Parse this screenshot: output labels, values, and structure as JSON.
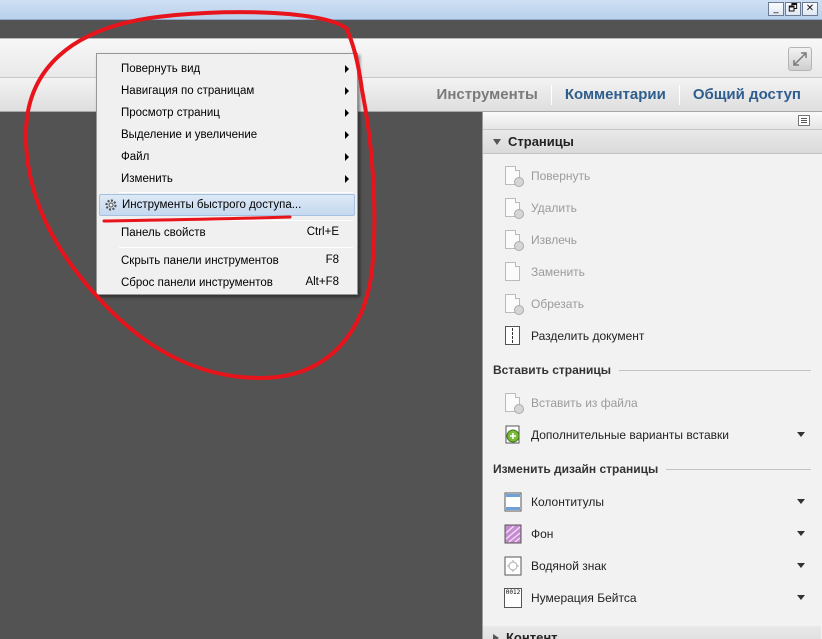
{
  "window": {
    "buttons": [
      "_",
      "🗗",
      "✕"
    ]
  },
  "tabs": [
    {
      "label": "Инструменты",
      "state": "inactive"
    },
    {
      "label": "Комментарии",
      "state": "active"
    },
    {
      "label": "Общий доступ",
      "state": "active"
    }
  ],
  "menu": {
    "items": [
      {
        "label": "Повернуть вид",
        "submenu": true
      },
      {
        "label": "Навигация по страницам",
        "submenu": true
      },
      {
        "label": "Просмотр страниц",
        "submenu": true
      },
      {
        "label": "Выделение и увеличение",
        "submenu": true
      },
      {
        "label": "Файл",
        "submenu": true
      },
      {
        "label": "Изменить",
        "submenu": true
      },
      {
        "label": "Инструменты быстрого доступа...",
        "highlighted": true,
        "icon": "gear-icon"
      },
      {
        "label": "Панель свойств",
        "shortcut": "Ctrl+E"
      },
      {
        "label": "Скрыть панели инструментов",
        "shortcut": "F8"
      },
      {
        "label": "Сброс панели инструментов",
        "shortcut": "Alt+F8"
      }
    ]
  },
  "panel": {
    "section_pages": "Страницы",
    "page_items": [
      {
        "label": "Повернуть",
        "enabled": false,
        "icon": "rotate-page-icon"
      },
      {
        "label": "Удалить",
        "enabled": false,
        "icon": "delete-page-icon"
      },
      {
        "label": "Извлечь",
        "enabled": false,
        "icon": "extract-page-icon"
      },
      {
        "label": "Заменить",
        "enabled": false,
        "icon": "replace-page-icon"
      },
      {
        "label": "Обрезать",
        "enabled": false,
        "icon": "crop-page-icon"
      },
      {
        "label": "Разделить документ",
        "enabled": true,
        "icon": "split-document-icon"
      }
    ],
    "insert_heading": "Вставить страницы",
    "insert_items": [
      {
        "label": "Вставить из файла",
        "enabled": false,
        "icon": "insert-from-file-icon"
      },
      {
        "label": "Дополнительные варианты вставки",
        "enabled": true,
        "icon": "more-insert-options-icon",
        "dropdown": true
      }
    ],
    "design_heading": "Изменить дизайн страницы",
    "design_items": [
      {
        "label": "Колонтитулы",
        "enabled": true,
        "icon": "header-footer-icon",
        "dropdown": true
      },
      {
        "label": "Фон",
        "enabled": true,
        "icon": "background-icon",
        "dropdown": true
      },
      {
        "label": "Водяной знак",
        "enabled": true,
        "icon": "watermark-icon",
        "dropdown": true
      },
      {
        "label": "Нумерация Бейтса",
        "enabled": true,
        "icon": "bates-numbering-icon",
        "dropdown": true,
        "icon_text": "0012"
      }
    ],
    "section_content": "Контент"
  },
  "colors": {
    "annotation_red": "#e8141c",
    "active_tab": "#2f5d8d",
    "workspace": "#535353"
  }
}
